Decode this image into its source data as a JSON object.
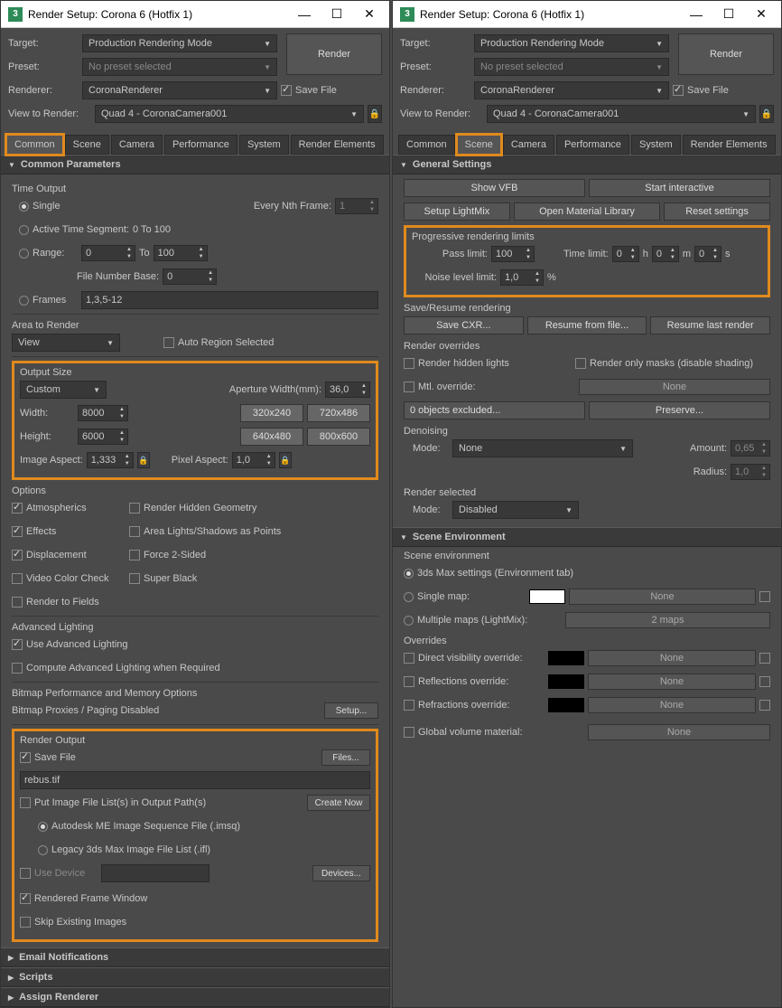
{
  "window_title": "Render Setup: Corona 6 (Hotfix 1)",
  "target_label": "Target:",
  "target_value": "Production Rendering Mode",
  "preset_label": "Preset:",
  "preset_value": "No preset selected",
  "renderer_label": "Renderer:",
  "renderer_value": "CoronaRenderer",
  "savefile_label": "Save File",
  "render_label": "Render",
  "view_label": "View to Render:",
  "view_value": "Quad 4 - CoronaCamera001",
  "tabs": [
    "Common",
    "Scene",
    "Camera",
    "Performance",
    "System",
    "Render Elements"
  ],
  "common": {
    "section_title": "Common Parameters",
    "time_output": "Time Output",
    "single": "Single",
    "every_nth": "Every Nth Frame:",
    "every_nth_val": "1",
    "active_seg": "Active Time Segment:",
    "active_seg_val": "0 To 100",
    "range": "Range:",
    "range_from": "0",
    "range_to_lbl": "To",
    "range_to": "100",
    "file_num": "File Number Base:",
    "file_num_val": "0",
    "frames": "Frames",
    "frames_val": "1,3,5-12",
    "area": "Area to Render",
    "area_val": "View",
    "auto_region": "Auto Region Selected",
    "out_size": "Output Size",
    "out_size_val": "Custom",
    "aperture": "Aperture Width(mm):",
    "aperture_val": "36,0",
    "width_lbl": "Width:",
    "width_val": "8000",
    "height_lbl": "Height:",
    "height_val": "6000",
    "presets": [
      "320x240",
      "720x486",
      "640x480",
      "800x600"
    ],
    "img_aspect": "Image Aspect:",
    "img_aspect_val": "1,333",
    "pix_aspect": "Pixel Aspect:",
    "pix_aspect_val": "1,0",
    "options": "Options",
    "opt_atmos": "Atmospherics",
    "opt_rhg": "Render Hidden Geometry",
    "opt_effects": "Effects",
    "opt_alsp": "Area Lights/Shadows as Points",
    "opt_disp": "Displacement",
    "opt_f2s": "Force 2-Sided",
    "opt_vcc": "Video Color Check",
    "opt_sb": "Super Black",
    "opt_rtf": "Render to Fields",
    "adv_light": "Advanced Lighting",
    "use_adv": "Use Advanced Lighting",
    "comp_adv": "Compute Advanced Lighting when Required",
    "bmp_perf": "Bitmap Performance and Memory Options",
    "bmp_prox": "Bitmap Proxies / Paging Disabled",
    "setup": "Setup...",
    "render_output": "Render Output",
    "save_file": "Save File",
    "files": "Files...",
    "filename": "rebus.tif",
    "put_list": "Put Image File List(s) in Output Path(s)",
    "create_now": "Create Now",
    "autodesk": "Autodesk ME Image Sequence File (.imsq)",
    "legacy": "Legacy 3ds Max Image File List (.ifl)",
    "use_device": "Use Device",
    "devices": "Devices...",
    "rfw": "Rendered Frame Window",
    "skip": "Skip Existing Images",
    "email": "Email Notifications",
    "scripts": "Scripts",
    "assign": "Assign Renderer"
  },
  "scene": {
    "general": "General Settings",
    "show_vfb": "Show VFB",
    "start_int": "Start interactive",
    "setup_lm": "Setup LightMix",
    "open_mat": "Open Material Library",
    "reset": "Reset settings",
    "prog_limits": "Progressive rendering limits",
    "pass_limit": "Pass limit:",
    "pass_val": "100",
    "time_limit": "Time limit:",
    "t_h": "0",
    "t_m": "0",
    "t_s": "0",
    "h": "h",
    "m": "m",
    "s": "s",
    "noise": "Noise level limit:",
    "noise_val": "1,0",
    "pct": "%",
    "save_resume": "Save/Resume rendering",
    "save_cxr": "Save CXR...",
    "resume_file": "Resume from file...",
    "resume_last": "Resume last render",
    "overrides": "Render overrides",
    "hidden_lights": "Render hidden lights",
    "only_masks": "Render only masks (disable shading)",
    "mtl_override": "Mtl. override:",
    "none": "None",
    "objs_excluded": "0 objects excluded...",
    "preserve": "Preserve...",
    "denoise": "Denoising",
    "mode": "Mode:",
    "denoise_mode": "None",
    "amount": "Amount:",
    "amount_val": "0,65",
    "radius_lbl": "Radius:",
    "radius_val": "1,0",
    "render_sel": "Render selected",
    "sel_mode": "Disabled",
    "scene_env_hdr": "Scene Environment",
    "scene_env": "Scene environment",
    "env_3ds": "3ds Max settings (Environment tab)",
    "single_map": "Single map:",
    "multi_maps": "Multiple maps (LightMix):",
    "two_maps": "2 maps",
    "overrides2": "Overrides",
    "dir_vis": "Direct visibility override:",
    "refl": "Reflections override:",
    "refr": "Refractions override:",
    "glob_vol": "Global volume material:"
  }
}
